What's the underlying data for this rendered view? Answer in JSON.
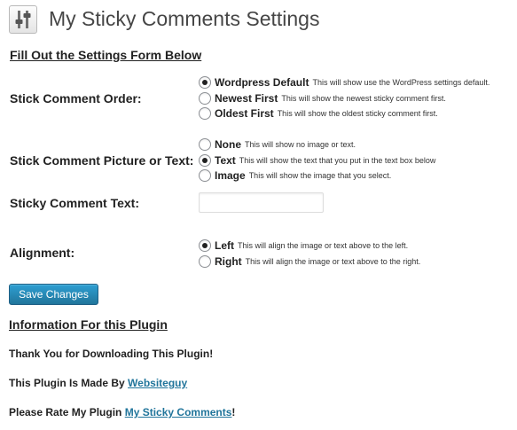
{
  "header": {
    "title": "My Sticky Comments Settings",
    "icon": "settings-sliders-icon"
  },
  "form": {
    "heading": "Fill Out the Settings Form Below",
    "order": {
      "label": "Stick Comment Order:",
      "options": [
        {
          "label": "Wordpress Default",
          "desc": "This will show use the WordPress settings default.",
          "checked": true
        },
        {
          "label": "Newest First",
          "desc": "This will show the newest sticky comment first.",
          "checked": false
        },
        {
          "label": "Oldest First",
          "desc": "This will show the oldest sticky comment first.",
          "checked": false
        }
      ]
    },
    "picture": {
      "label": "Stick Comment Picture or Text:",
      "options": [
        {
          "label": "None",
          "desc": "This will show no image or text.",
          "checked": false
        },
        {
          "label": "Text",
          "desc": "This will show the text that you put in the text box below",
          "checked": true
        },
        {
          "label": "Image",
          "desc": "This will show the image that you select.",
          "checked": false
        }
      ]
    },
    "text": {
      "label": "Sticky Comment Text:",
      "value": ""
    },
    "alignment": {
      "label": "Alignment:",
      "options": [
        {
          "label": "Left",
          "desc": "This will align the image or text above to the left.",
          "checked": true
        },
        {
          "label": "Right",
          "desc": "This will align the image or text above to the right.",
          "checked": false
        }
      ]
    },
    "save_label": "Save Changes"
  },
  "info": {
    "heading": "Information For this Plugin",
    "thanks": "Thank You for Downloading This Plugin!",
    "made_by_prefix": "This Plugin Is Made By ",
    "made_by_link": "Websiteguy",
    "rate_prefix": "Please Rate My Plugin ",
    "rate_link": "My Sticky Comments",
    "rate_suffix": "!"
  },
  "colors": {
    "link": "#21759b",
    "button": "#21759b",
    "title": "#464646"
  }
}
